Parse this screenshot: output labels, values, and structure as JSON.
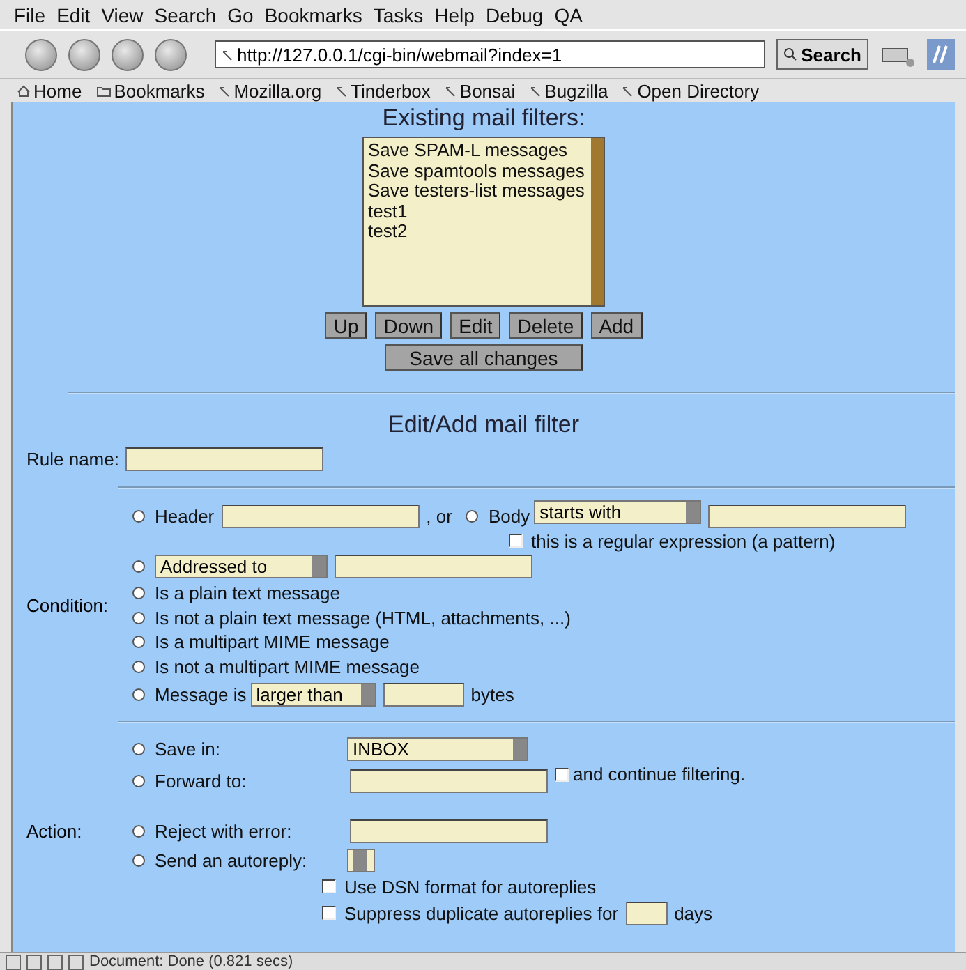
{
  "menu": [
    "File",
    "Edit",
    "View",
    "Search",
    "Go",
    "Bookmarks",
    "Tasks",
    "Help",
    "Debug",
    "QA"
  ],
  "toolbar": {
    "url": "http://127.0.0.1/cgi-bin/webmail?index=1",
    "search_button": "Search"
  },
  "personal_bar": [
    {
      "kind": "home",
      "label": "Home"
    },
    {
      "kind": "folder",
      "label": "Bookmarks"
    },
    {
      "kind": "link",
      "label": "Mozilla.org"
    },
    {
      "kind": "link",
      "label": "Tinderbox"
    },
    {
      "kind": "link",
      "label": "Bonsai"
    },
    {
      "kind": "link",
      "label": "Bugzilla"
    },
    {
      "kind": "link",
      "label": "Open Directory"
    }
  ],
  "filters": {
    "title": "Existing mail filters:",
    "items": [
      {
        "label": "Save SPAM-L messages",
        "selected": false
      },
      {
        "label": "Save spamtools messages",
        "selected": false
      },
      {
        "label": "Save testers-list messages",
        "selected": false
      },
      {
        "label": "test1",
        "selected": false
      },
      {
        "label": "test2",
        "selected": false
      }
    ],
    "buttons": [
      "Up",
      "Down",
      "Edit",
      "Delete",
      "Add"
    ],
    "save_button": "Save all changes"
  },
  "edit": {
    "title": "Edit/Add mail filter",
    "rule_name_label": "Rule name:",
    "condition": {
      "label": "Condition:",
      "rows": [
        {
          "kind": "header-body",
          "selected": false,
          "header_label": "Header",
          "or_label": ", or",
          "body_selected": false,
          "body_label": "Body",
          "match": "starts with",
          "regex_label": "this is a regular expression (a pattern)",
          "regex_checked": false
        },
        {
          "kind": "addressed",
          "selected": false,
          "select": "Addressed to"
        },
        {
          "kind": "text",
          "selected": false,
          "label": "Is a plain text message"
        },
        {
          "kind": "text",
          "selected": false,
          "label": "Is not a plain text message (HTML, attachments, ...)"
        },
        {
          "kind": "text",
          "selected": false,
          "label": "Is a multipart MIME message"
        },
        {
          "kind": "text",
          "selected": false,
          "label": "Is not a multipart MIME message"
        },
        {
          "kind": "size",
          "selected": false,
          "label": "Message is",
          "select": "larger than",
          "unit": "bytes"
        }
      ]
    },
    "action": {
      "label": "Action:",
      "save_in_label": "Save in:",
      "save_in_selected": false,
      "folder": "INBOX",
      "forward_label": "Forward to:",
      "forward_selected": false,
      "continue_label": "and continue filtering.",
      "continue_checked": false,
      "reject_label": "Reject with error:",
      "reject_selected": false,
      "autoreply_label": "Send an autoreply:",
      "autoreply_selected": false,
      "dsn_label": "Use DSN format for autoreplies",
      "dsn_checked": false,
      "suppress_label": "Suppress duplicate autoreplies for",
      "suppress_checked": false,
      "days_label": "days"
    }
  },
  "status": "Document: Done (0.821 secs)"
}
